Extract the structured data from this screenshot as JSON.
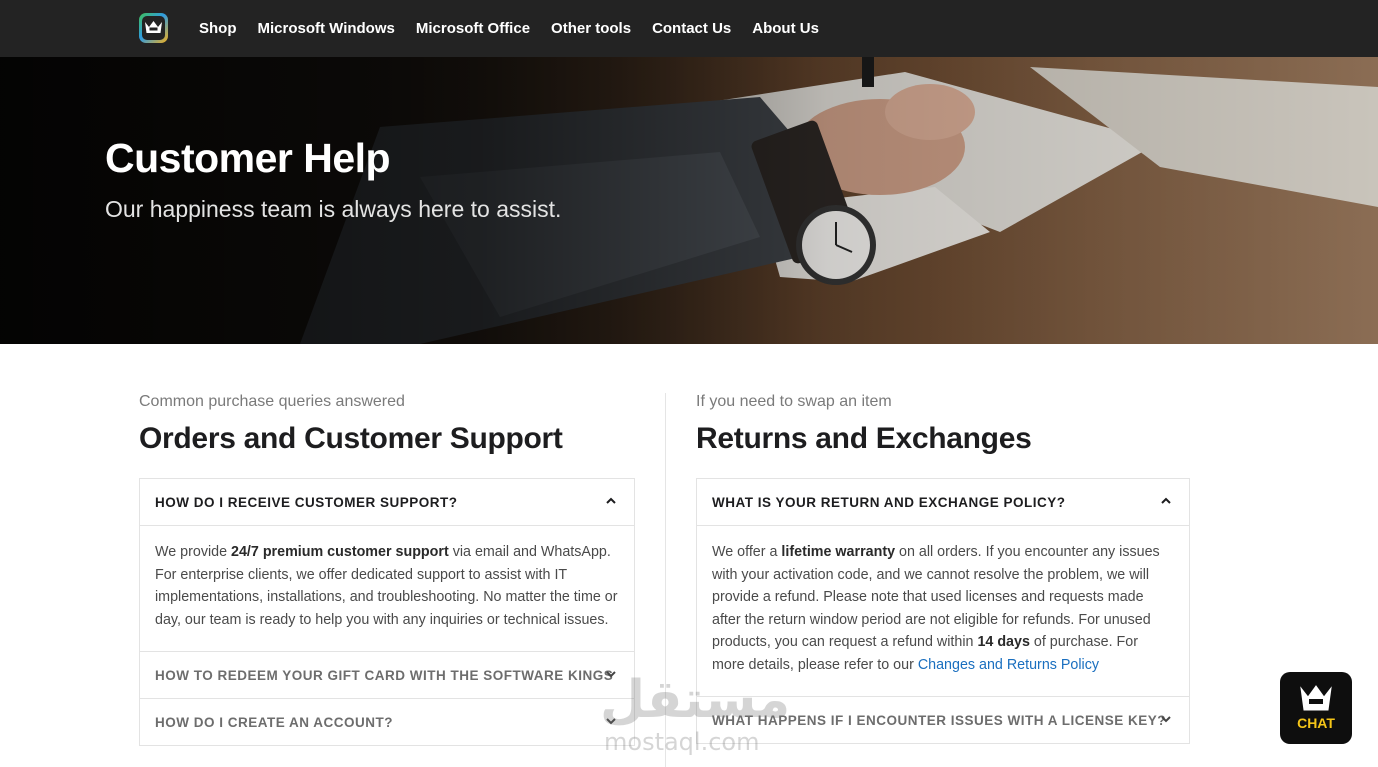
{
  "nav": {
    "logo_icon": "crown-logo-icon",
    "links": [
      "Shop",
      "Microsoft Windows",
      "Microsoft Office",
      "Other tools",
      "Contact Us",
      "About Us"
    ]
  },
  "hero": {
    "title": "Customer Help",
    "subtitle": "Our happiness team is always here to assist."
  },
  "orders": {
    "eyebrow": "Common purchase queries answered",
    "title": "Orders and Customer Support",
    "items": [
      {
        "question": "HOW DO I RECEIVE CUSTOMER SUPPORT?",
        "expanded": true,
        "answer": {
          "p1": "We provide ",
          "b1": "24/7 premium customer support",
          "p2": " via email and WhatsApp. For enterprise clients, we offer dedicated support to assist with IT implementations, installations, and troubleshooting. No matter the time or day, our team is ready to help you with any inquiries or technical issues."
        }
      },
      {
        "question": "HOW TO REDEEM YOUR GIFT CARD WITH THE SOFTWARE KINGS",
        "expanded": false
      },
      {
        "question": "HOW DO I CREATE AN ACCOUNT?",
        "expanded": false
      }
    ]
  },
  "returns": {
    "eyebrow": "If you need to swap an item",
    "title": "Returns and Exchanges",
    "items": [
      {
        "question": "WHAT IS YOUR RETURN AND EXCHANGE POLICY?",
        "expanded": true,
        "answer": {
          "p1": "We offer a ",
          "b1": "lifetime warranty",
          "p2": " on all orders. If you encounter any issues with your activation code, and we cannot resolve the problem, we will provide a refund. Please note that used licenses and requests made after the return window period are not eligible for refunds. For unused products, you can request a refund within ",
          "b2": "14 days",
          "p3": " of purchase. For more details, please refer to our ",
          "link": "Changes and Returns Policy"
        }
      },
      {
        "question": "WHAT HAPPENS IF I ENCOUNTER ISSUES WITH A LICENSE KEY?",
        "expanded": false
      }
    ]
  },
  "chat": {
    "label": "CHAT",
    "icon": "crown-chat-icon"
  },
  "watermark": {
    "main": "مستقل",
    "sub": "mostaql.com"
  },
  "colors": {
    "nav_bg": "#232323",
    "link": "#1a6fbf",
    "chat_accent": "#f5c518"
  }
}
